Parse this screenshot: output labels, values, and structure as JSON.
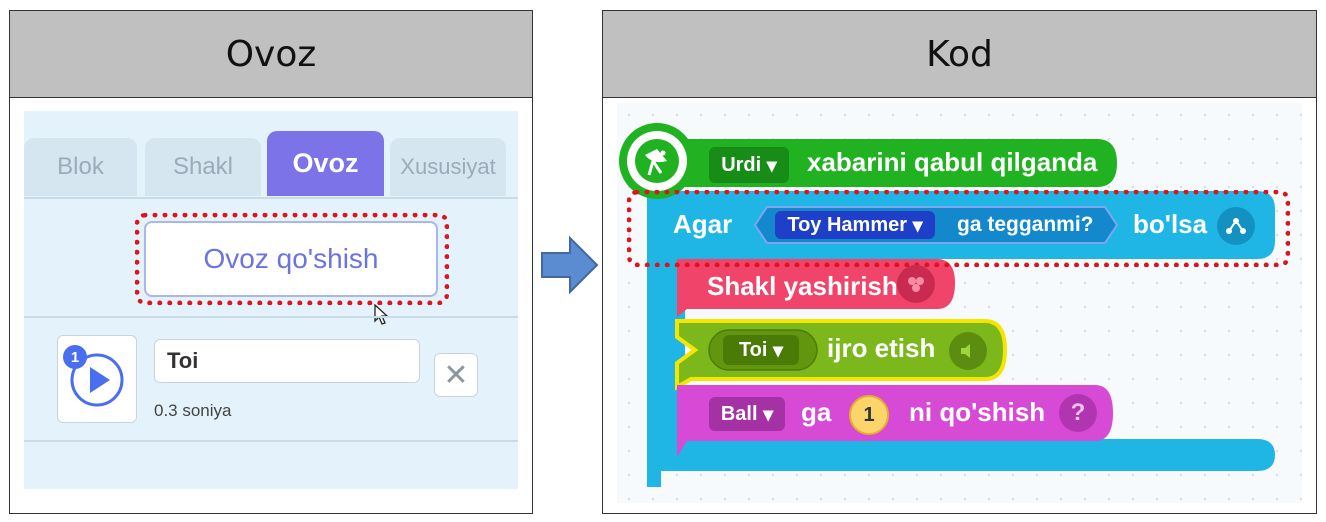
{
  "left_panel": {
    "header": "Ovoz",
    "tabs": [
      "Blok",
      "Shakl",
      "Ovoz",
      "Xususiyat"
    ],
    "active_tab": "Ovoz",
    "add_sound_label": "Ovoz qo'shish",
    "sound_item": {
      "index": "1",
      "name": "Toi",
      "duration": "0.3 soniya"
    }
  },
  "right_panel": {
    "header": "Kod",
    "blocks": {
      "event": {
        "dropdown": "Urdi",
        "text": "xabarini qabul qilganda"
      },
      "if": {
        "prefix": "Agar",
        "object_dropdown": "Toy Hammer",
        "condition_text": "ga tegganmi?",
        "suffix": "bo'lsa"
      },
      "hide": {
        "text": "Shakl yashirish"
      },
      "play": {
        "dropdown": "Toi",
        "text": "ijro etish"
      },
      "add": {
        "dropdown": "Ball",
        "text_ga": "ga",
        "value": "1",
        "text_end": "ni qo'shish",
        "help": "?"
      }
    }
  },
  "colors": {
    "event_green": "#20b220",
    "if_blue": "#1fb6e6",
    "looks_pink": "#f0446a",
    "sound_green": "#7cb81c",
    "variable_magenta": "#d74ad6",
    "tab_active": "#7c73e8",
    "highlight_red": "#e0121c"
  }
}
